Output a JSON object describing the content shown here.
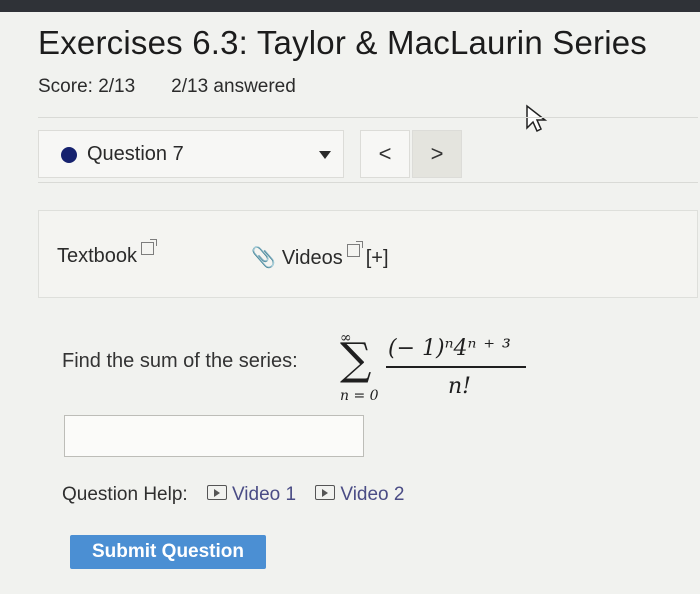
{
  "header": {
    "title": "Exercises 6.3: Taylor & MacLaurin Series",
    "score": "Score: 2/13",
    "answered": "2/13 answered"
  },
  "question_nav": {
    "selected": "Question 7",
    "prev_label": "<",
    "next_label": ">"
  },
  "resources": {
    "textbook_label": "Textbook",
    "videos_label": "Videos",
    "expand_label": "[+]"
  },
  "problem": {
    "prompt": "Find the sum of the series:",
    "series_upper": "∞",
    "series_lower": "n = 0",
    "numerator": "(− 1)ⁿ4ⁿ ⁺ ³",
    "denominator": "n!"
  },
  "answer": {
    "value": ""
  },
  "help": {
    "label": "Question Help:",
    "video1": "Video 1",
    "video2": "Video 2"
  },
  "submit_label": "Submit Question",
  "icons": {
    "status_dot": "filled-circle-icon",
    "external": "external-link-icon",
    "paperclip": "paperclip-icon",
    "play": "play-icon",
    "cursor": "mouse-pointer-icon"
  },
  "colors": {
    "status_dot": "#16226e",
    "submit_button": "#4b8fd3",
    "video_link": "#4a4c85"
  }
}
